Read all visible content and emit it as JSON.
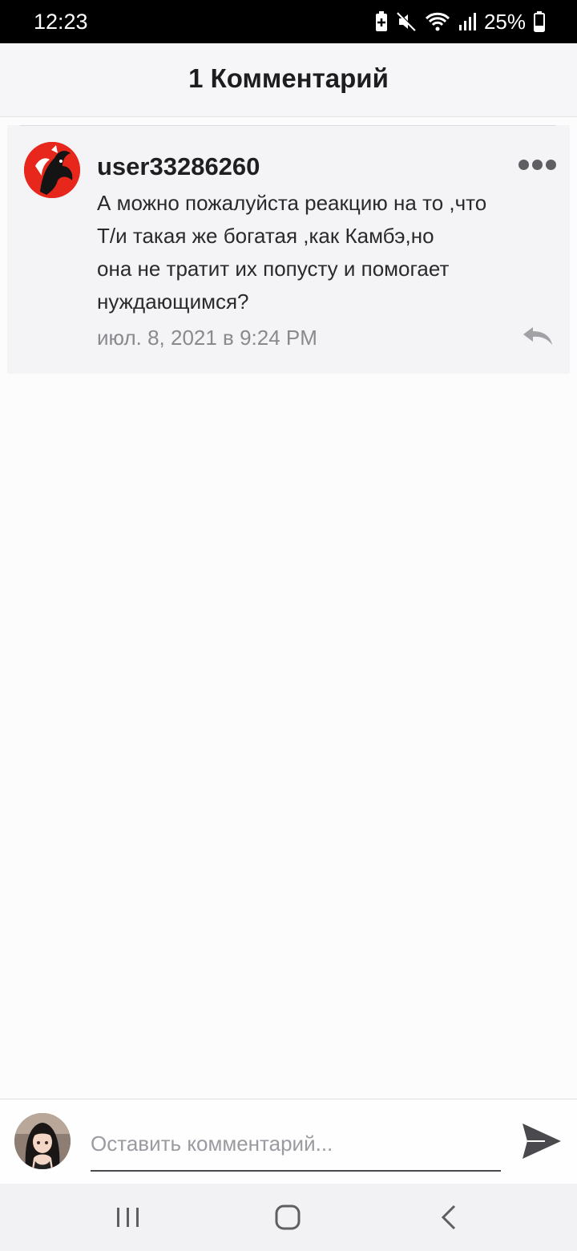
{
  "status_bar": {
    "time": "12:23",
    "battery_percent": "25%",
    "icons": [
      "battery-saver-icon",
      "mute-icon",
      "wifi-icon",
      "signal-icon",
      "battery-icon"
    ]
  },
  "header": {
    "title": "1 Комментарий"
  },
  "comments": [
    {
      "username": "user33286260",
      "text": "А можно пожалуйста реакцию на то ,что\nТ/и такая же богатая ,как Камбэ,но\nона не тратит их попусту и помогает\nнуждающимся?",
      "date": "июл. 8, 2021 в 9:24 PM",
      "avatar_icon": "user-avatar-icon",
      "actions": [
        "more-options-icon",
        "reply-icon"
      ]
    }
  ],
  "composer": {
    "placeholder": "Оставить комментарий...",
    "value": "",
    "send_icon": "send-icon"
  },
  "navbar": {
    "icons": [
      "recent-apps-icon",
      "home-icon",
      "back-icon"
    ]
  },
  "colors": {
    "header_bg": "#f6f5f8",
    "card_bg": "#f4f3f6",
    "avatar_red": "#e8271c",
    "text_dark": "#1f1f22",
    "text_muted": "#8a898e"
  }
}
